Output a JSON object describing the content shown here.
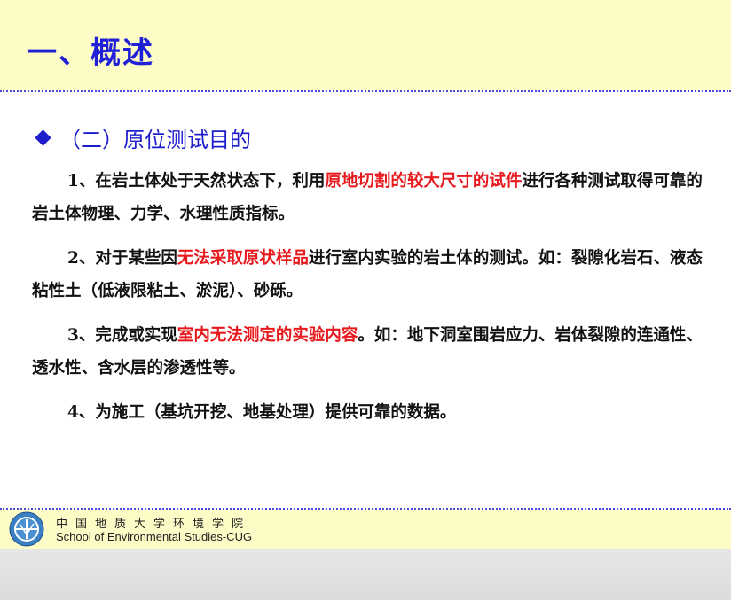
{
  "header": {
    "title": "一、概述"
  },
  "section": {
    "heading": "（二）原位测试目的"
  },
  "paragraphs": [
    {
      "pre": "1、在岩土体处于天然状态下，利用",
      "highlight": "原地切割的较大尺寸的试件",
      "post": "进行各种测试取得可靠的岩土体物理、力学、水理性质指标。"
    },
    {
      "pre": "2、对于某些因",
      "highlight": "无法采取原状样品",
      "post": "进行室内实验的岩土体的测试。如：裂隙化岩石、液态粘性土（低液限粘土、淤泥）、砂砾。"
    },
    {
      "pre": "3、完成或实现",
      "highlight": "室内无法测定的实验内容",
      "post": "。如：地下洞室围岩应力、岩体裂隙的连通性、透水性、含水层的渗透性等。"
    },
    {
      "pre": "4、为施工（基坑开挖、地基处理）提供可靠的数据。",
      "highlight": "",
      "post": ""
    }
  ],
  "footer": {
    "cn": "中国地质大学环境学院",
    "en": "School of Environmental Studies-CUG",
    "logo_icon": "university-emblem-icon"
  },
  "colors": {
    "title": "#2020d8",
    "highlight": "#e8191d",
    "band": "#fdfcc6"
  }
}
